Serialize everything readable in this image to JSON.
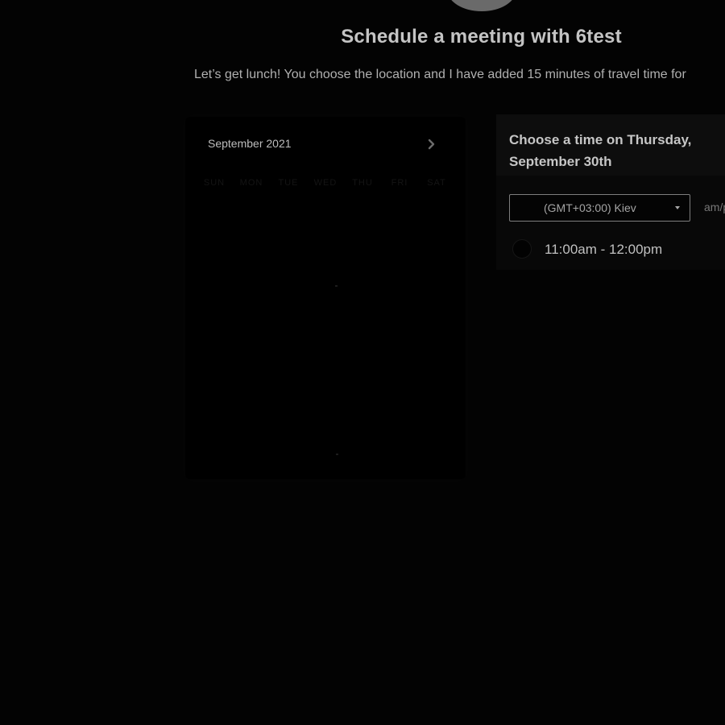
{
  "header": {
    "title": "Schedule a meeting with 6test",
    "description": "Let’s get lunch! You choose the location and I have added 15 minutes of travel time for"
  },
  "calendar": {
    "month_label": "September 2021",
    "next_icon": "chevron-right-icon",
    "weekdays": [
      "SUN",
      "MON",
      "TUE",
      "WED",
      "THU",
      "FRI",
      "SAT"
    ]
  },
  "time_panel": {
    "heading": "Choose a time on Thursday, September 30th",
    "timezone": "(GMT+03:00) Kiev",
    "format_toggle": "am/pm",
    "slots": [
      {
        "label": "11:00am - 12:00pm"
      }
    ]
  },
  "colors": {
    "background": "#030303",
    "title": "#c4c4c4",
    "text": "#b0b0b0"
  }
}
